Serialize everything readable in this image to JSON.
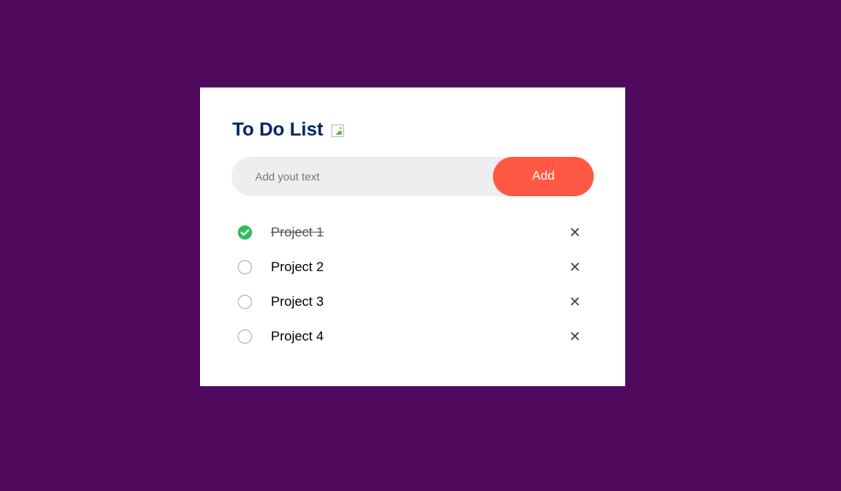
{
  "app": {
    "title": "To Do List",
    "title_color": "#002765",
    "background_color": "#4f0a5e",
    "accent_color": "#ff5945",
    "check_color": "#2fbd5b"
  },
  "input": {
    "placeholder": "Add yout text",
    "value": ""
  },
  "add_button": {
    "label": "Add"
  },
  "tasks": [
    {
      "label": "Project 1",
      "done": true,
      "remove_glyph": "✕"
    },
    {
      "label": "Project 2",
      "done": false,
      "remove_glyph": "✕"
    },
    {
      "label": "Project 3",
      "done": false,
      "remove_glyph": "✕"
    },
    {
      "label": "Project 4",
      "done": false,
      "remove_glyph": "✕"
    }
  ],
  "icons": {
    "title_image": "broken-image-icon",
    "checked": "check-circle-icon",
    "unchecked": "empty-circle-icon",
    "remove": "close-icon"
  }
}
